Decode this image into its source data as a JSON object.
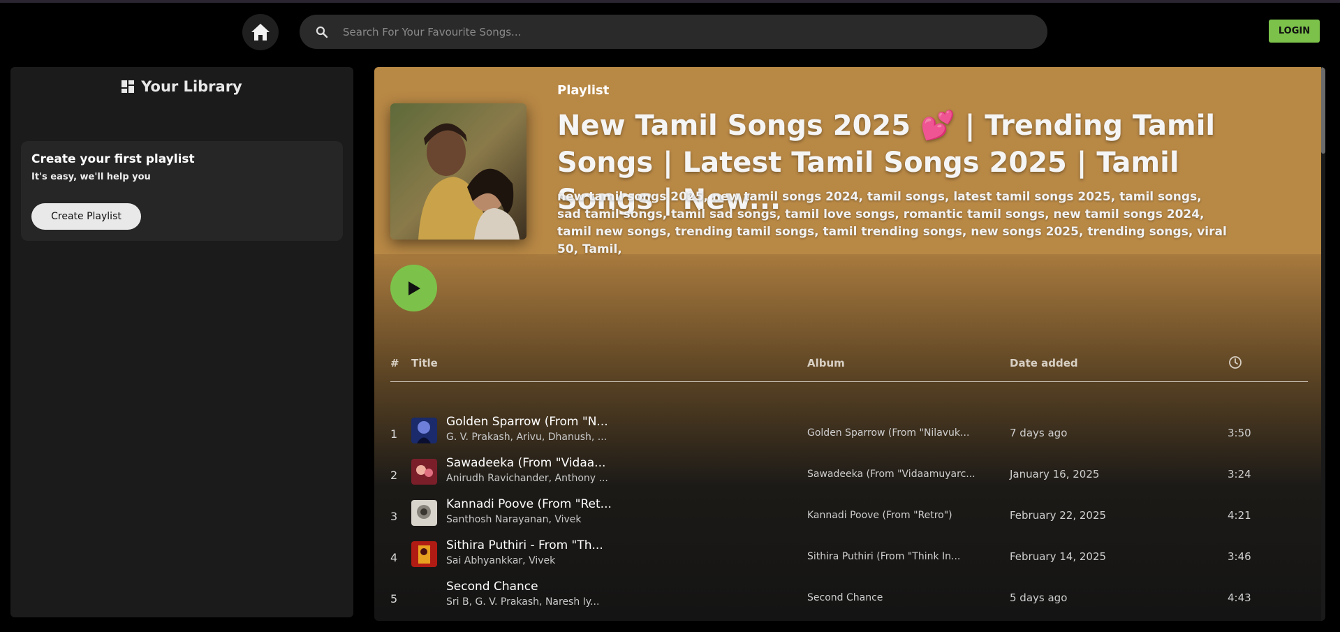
{
  "header": {
    "home_icon": "home-icon",
    "search_icon": "search-icon",
    "search_placeholder": "Search For Your Favourite Songs...",
    "search_value": "",
    "login_label": "LOGIN"
  },
  "sidebar": {
    "library_icon": "dashboard-grid-icon",
    "title": "Your Library",
    "card": {
      "title": "Create your first playlist",
      "subtitle": "It's easy, we'll help you",
      "button_label": "Create Playlist"
    }
  },
  "playlist": {
    "type_label": "Playlist",
    "title": "New Tamil Songs 2025 💕 | Trending Tamil Songs | Latest Tamil Songs 2025 | Tamil Songs | New...",
    "description": "new tamil songs 2025, new tamil songs 2024, tamil songs, latest tamil songs 2025, tamil songs, sad tamil songs, tamil sad songs, tamil love songs, romantic tamil songs, new tamil songs 2024, tamil new songs, trending tamil songs, tamil trending songs, new songs 2025, trending songs, viral 50, Tamil,",
    "play_icon": "play-icon"
  },
  "table": {
    "headers": {
      "num": "#",
      "title": "Title",
      "album": "Album",
      "date": "Date added",
      "duration_icon": "clock-icon"
    },
    "rows": [
      {
        "num": "1",
        "name": "Golden Sparrow (From \"N...",
        "artists": "G. V. Prakash, Arivu, Dhanush, ...",
        "album": "Golden Sparrow (From \"Nilavuk...",
        "date": "7 days ago",
        "duration": "3:50"
      },
      {
        "num": "2",
        "name": "Sawadeeka (From \"Vidaa...",
        "artists": "Anirudh Ravichander, Anthony ...",
        "album": "Sawadeeka (From \"Vidaamuyarc...",
        "date": "January 16, 2025",
        "duration": "3:24"
      },
      {
        "num": "3",
        "name": "Kannadi Poove (From \"Ret...",
        "artists": "Santhosh Narayanan, Vivek",
        "album": "Kannadi Poove (From \"Retro\")",
        "date": "February 22, 2025",
        "duration": "4:21"
      },
      {
        "num": "4",
        "name": "Sithira Puthiri - From \"Th...",
        "artists": "Sai Abhyankkar, Vivek",
        "album": "Sithira Puthiri (From \"Think In...",
        "date": "February 14, 2025",
        "duration": "3:46"
      },
      {
        "num": "5",
        "name": "Second Chance",
        "artists": "Sri B, G. V. Prakash, Naresh Iy...",
        "album": "Second Chance",
        "date": "5 days ago",
        "duration": "4:43"
      }
    ]
  },
  "colors": {
    "accent_green": "#7cc24a",
    "header_gold": "#b88845",
    "background": "#000000",
    "panel": "#1b1b1b"
  }
}
